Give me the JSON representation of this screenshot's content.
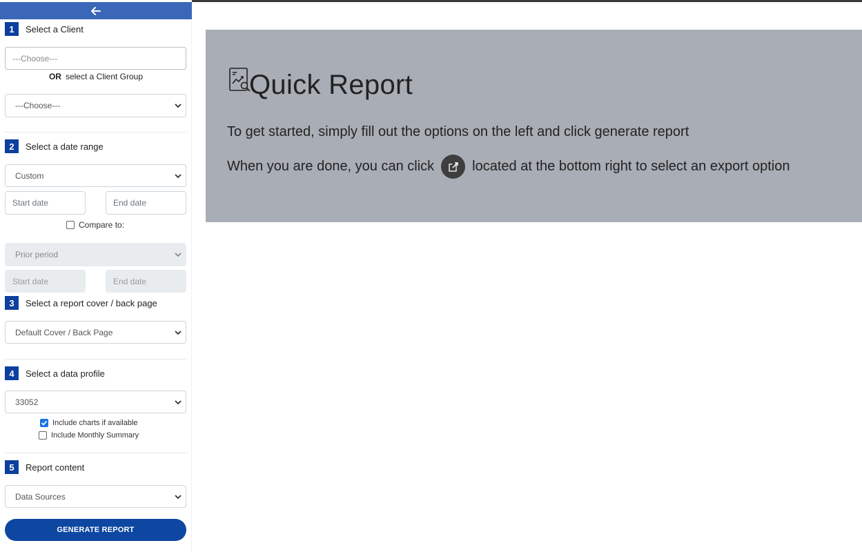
{
  "sidebar": {
    "collapse_icon": "arrow-left-icon",
    "step1": {
      "num": "1",
      "label": "Select a Client",
      "client_placeholder": "---Choose---",
      "or_bold": "OR",
      "or_text": "select a Client Group",
      "group_value": "---Choose---"
    },
    "step2": {
      "num": "2",
      "label": "Select a date range",
      "range_value": "Custom",
      "start_placeholder": "Start date",
      "end_placeholder": "End date",
      "compare_label": "Compare to:",
      "compare_checked": false,
      "compare_value": "Prior period",
      "compare_start_placeholder": "Start date",
      "compare_end_placeholder": "End date"
    },
    "step3": {
      "num": "3",
      "label": "Select a report cover / back page",
      "cover_value": "Default Cover / Back Page"
    },
    "step4": {
      "num": "4",
      "label": "Select a data profile",
      "profile_value": "33052",
      "include_charts_label": "Include charts if available",
      "include_charts_checked": true,
      "include_monthly_label": "Include Monthly Summary",
      "include_monthly_checked": false
    },
    "step5": {
      "num": "5",
      "label": "Report content",
      "content_value": "Data Sources"
    },
    "generate_label": "GENERATE REPORT"
  },
  "main": {
    "title": "Quick Report",
    "title_icon": "report-chart-icon",
    "line1": "To get started, simply fill out the options on the left and click generate report",
    "line2_before": "When you are done, you can click",
    "line2_icon": "export-icon",
    "line2_after": "located at the bottom right to select an export option"
  },
  "colors": {
    "accent": "#0d3f9e",
    "collapse_bar": "#3b67b8",
    "banner": "#a9adb5",
    "button": "#0d47a1"
  }
}
